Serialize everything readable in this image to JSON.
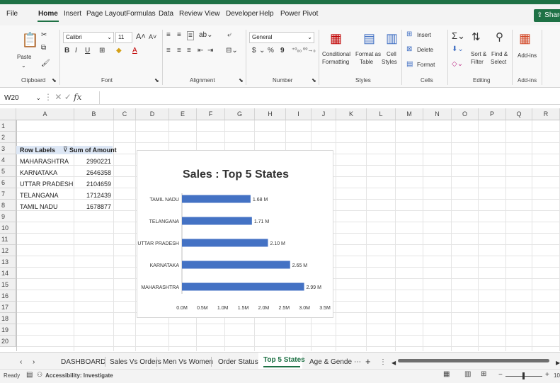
{
  "menu": {
    "tabs": [
      "File",
      "Home",
      "Insert",
      "Page Layout",
      "Formulas",
      "Data",
      "Review",
      "View",
      "Developer",
      "Help",
      "Power Pivot"
    ],
    "share": "Share"
  },
  "ribbon": {
    "clipboard": {
      "paste": "Paste",
      "group": "Clipboard"
    },
    "font": {
      "name": "Calibri",
      "size": "11",
      "group": "Font",
      "inc": "A",
      "dec": "A",
      "bold": "B",
      "italic": "I",
      "underline": "U",
      "fontcolor": "A"
    },
    "alignment": {
      "group": "Alignment"
    },
    "number": {
      "format": "General",
      "currency": "$",
      "percent": "%",
      "comma": "9",
      "group": "Number"
    },
    "styles": {
      "conditional1": "Conditional",
      "conditional2": "Formatting",
      "format_table1": "Format as",
      "format_table2": "Table",
      "cell_styles1": "Cell",
      "cell_styles2": "Styles",
      "group": "Styles"
    },
    "cells": {
      "insert": "Insert",
      "delete": "Delete",
      "format": "Format",
      "group": "Cells"
    },
    "editing": {
      "sort1": "Sort &",
      "sort2": "Filter",
      "find1": "Find &",
      "find2": "Select",
      "group": "Editing"
    },
    "addins": {
      "label": "Add-ins",
      "group": "Add-ins"
    }
  },
  "formula_bar": {
    "namebox": "W20",
    "fx": "fx",
    "content": ""
  },
  "columns": [
    "A",
    "B",
    "C",
    "D",
    "E",
    "F",
    "G",
    "H",
    "I",
    "J",
    "K",
    "L",
    "M",
    "N",
    "O",
    "P",
    "Q",
    "R"
  ],
  "rows": [
    "1",
    "2",
    "3",
    "4",
    "5",
    "6",
    "7",
    "8",
    "9",
    "10",
    "11",
    "12",
    "13",
    "14",
    "15",
    "16",
    "17",
    "18",
    "19",
    "20"
  ],
  "pivot": {
    "header_labels": "Row Labels",
    "header_sum": "Sum of Amount",
    "rows": [
      {
        "label": "MAHARASHTRA",
        "value": "2990221"
      },
      {
        "label": "KARNATAKA",
        "value": "2646358"
      },
      {
        "label": "UTTAR PRADESH",
        "value": "2104659"
      },
      {
        "label": "TELANGANA",
        "value": "1712439"
      },
      {
        "label": "TAMIL NADU",
        "value": "1678877"
      }
    ]
  },
  "chart_data": {
    "type": "bar",
    "orientation": "horizontal",
    "title": "Sales : Top 5 States",
    "categories": [
      "TAMIL NADU",
      "TELANGANA",
      "UTTAR PRADESH",
      "KARNATAKA",
      "MAHARASHTRA"
    ],
    "values": [
      1678877,
      1712439,
      2104659,
      2646358,
      2990221
    ],
    "data_labels": [
      "1.68 M",
      "1.71 M",
      "2.10 M",
      "2.65 M",
      "2.99 M"
    ],
    "xticks": [
      "0.0M",
      "0.5M",
      "1.0M",
      "1.5M",
      "2.0M",
      "2.5M",
      "3.0M",
      "3.5M"
    ],
    "xlim": [
      0,
      3500000
    ],
    "bar_color": "#4472c4",
    "grid": false,
    "legend": "none"
  },
  "sheet_tabs": [
    "DASHBOARD",
    "Sales Vs Orders",
    "Men Vs Women",
    "Order Status",
    "Top 5 States",
    "Age & Gende"
  ],
  "active_tab": "Top 5 States",
  "status": {
    "ready": "Ready",
    "accessibility": "Accessibility: Investigate",
    "zoom": "10"
  },
  "colors": {
    "accent": "#1e7145"
  }
}
